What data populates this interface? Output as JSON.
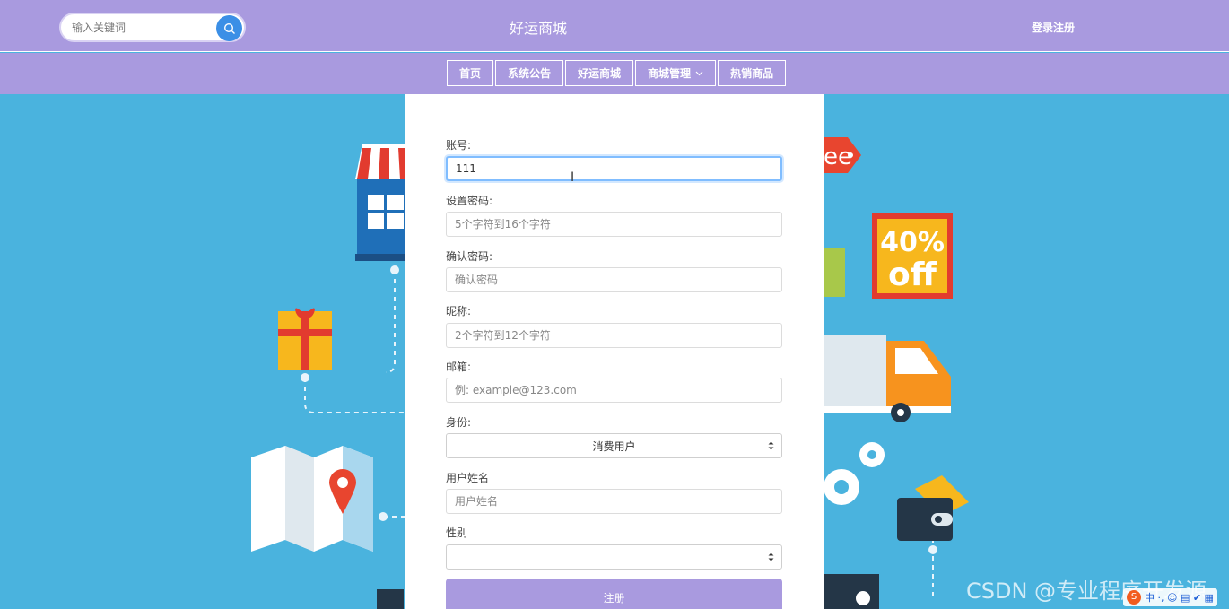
{
  "header": {
    "search_placeholder": "输入关键词",
    "site_title": "好运商城",
    "login_register": "登录注册"
  },
  "nav": {
    "items": [
      {
        "label": "首页"
      },
      {
        "label": "系统公告"
      },
      {
        "label": "好运商城"
      },
      {
        "label": "商城管理",
        "dropdown": true
      },
      {
        "label": "热销商品"
      }
    ]
  },
  "form": {
    "account_label": "账号:",
    "account_value": "111",
    "password_label": "设置密码:",
    "password_placeholder": "5个字符到16个字符",
    "confirm_label": "确认密码:",
    "confirm_placeholder": "确认密码",
    "nickname_label": "昵称:",
    "nickname_placeholder": "2个字符到12个字符",
    "email_label": "邮箱:",
    "email_placeholder": "例: example@123.com",
    "role_label": "身份:",
    "role_value": "消费用户",
    "name_label": "用户姓名",
    "name_placeholder": "用户姓名",
    "gender_label": "性别",
    "gender_value": "",
    "submit_label": "注册"
  },
  "background": {
    "price_tag_text": "ee",
    "discount_line1": "40%",
    "discount_line2": "off"
  },
  "overlay": {
    "watermark": "CSDN @专业程序开发源",
    "ime_logo": "S",
    "ime_text": "中 ·, ☺ ▤ ✔ ▦"
  },
  "colors": {
    "header_bg": "#a99adf",
    "page_bg": "#4ab3de",
    "search_button": "#3b8fe6",
    "focus_border": "#80bdff"
  }
}
